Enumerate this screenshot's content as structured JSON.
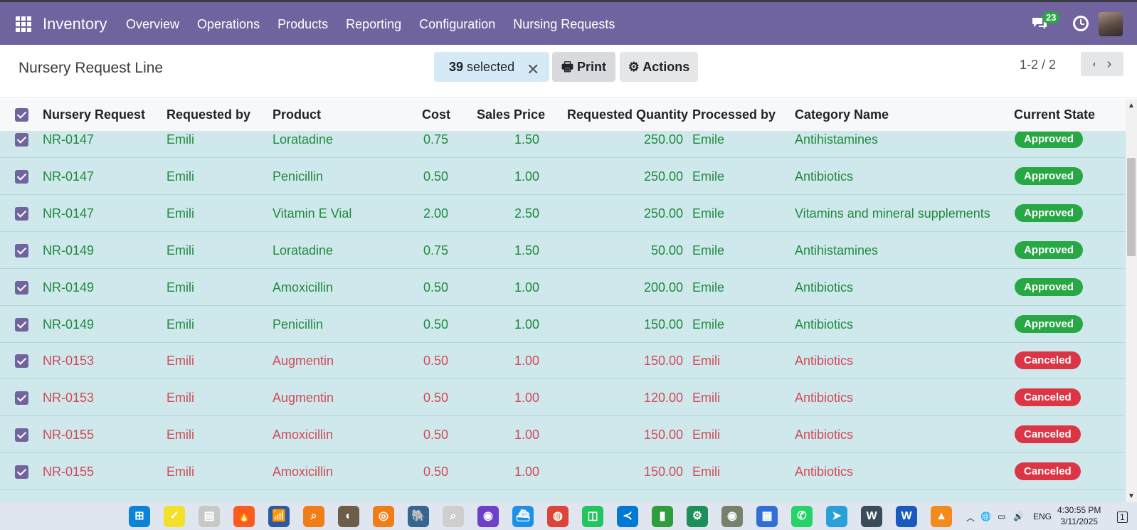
{
  "app": {
    "name": "Inventory",
    "menu": [
      "Overview",
      "Operations",
      "Products",
      "Reporting",
      "Configuration",
      "Nursing Requests"
    ],
    "messages_count": "23"
  },
  "control": {
    "title": "Nursery Request Line",
    "selected_count": "39",
    "selected_label": "selected",
    "print_label": "Print",
    "actions_label": "Actions",
    "pager": "1-2 / 2"
  },
  "columns": [
    "Nursery Request",
    "Requested by",
    "Product",
    "Cost",
    "Sales Price",
    "Requested Quantity",
    "Processed by",
    "Category Name",
    "Current State"
  ],
  "rows": [
    {
      "ref": "NR-0147",
      "requested_by": "Emili",
      "product": "Loratadine",
      "cost": "0.75",
      "sales_price": "1.50",
      "qty": "250.00",
      "processed_by": "Emile",
      "category": "Antihistamines",
      "state": "Approved"
    },
    {
      "ref": "NR-0147",
      "requested_by": "Emili",
      "product": "Penicillin",
      "cost": "0.50",
      "sales_price": "1.00",
      "qty": "250.00",
      "processed_by": "Emile",
      "category": "Antibiotics",
      "state": "Approved"
    },
    {
      "ref": "NR-0147",
      "requested_by": "Emili",
      "product": "Vitamin E Vial",
      "cost": "2.00",
      "sales_price": "2.50",
      "qty": "250.00",
      "processed_by": "Emile",
      "category": "Vitamins and mineral supplements",
      "state": "Approved"
    },
    {
      "ref": "NR-0149",
      "requested_by": "Emili",
      "product": "Loratadine",
      "cost": "0.75",
      "sales_price": "1.50",
      "qty": "50.00",
      "processed_by": "Emile",
      "category": "Antihistamines",
      "state": "Approved"
    },
    {
      "ref": "NR-0149",
      "requested_by": "Emili",
      "product": "Amoxicillin",
      "cost": "0.50",
      "sales_price": "1.00",
      "qty": "200.00",
      "processed_by": "Emile",
      "category": "Antibiotics",
      "state": "Approved"
    },
    {
      "ref": "NR-0149",
      "requested_by": "Emili",
      "product": "Penicillin",
      "cost": "0.50",
      "sales_price": "1.00",
      "qty": "150.00",
      "processed_by": "Emile",
      "category": "Antibiotics",
      "state": "Approved"
    },
    {
      "ref": "NR-0153",
      "requested_by": "Emili",
      "product": "Augmentin",
      "cost": "0.50",
      "sales_price": "1.00",
      "qty": "150.00",
      "processed_by": "Emili",
      "category": "Antibiotics",
      "state": "Canceled"
    },
    {
      "ref": "NR-0153",
      "requested_by": "Emili",
      "product": "Augmentin",
      "cost": "0.50",
      "sales_price": "1.00",
      "qty": "120.00",
      "processed_by": "Emili",
      "category": "Antibiotics",
      "state": "Canceled"
    },
    {
      "ref": "NR-0155",
      "requested_by": "Emili",
      "product": "Amoxicillin",
      "cost": "0.50",
      "sales_price": "1.00",
      "qty": "150.00",
      "processed_by": "Emili",
      "category": "Antibiotics",
      "state": "Canceled"
    },
    {
      "ref": "NR-0155",
      "requested_by": "Emili",
      "product": "Amoxicillin",
      "cost": "0.50",
      "sales_price": "1.00",
      "qty": "150.00",
      "processed_by": "Emili",
      "category": "Antibiotics",
      "state": "Canceled"
    }
  ],
  "colors": {
    "navbar": "#71639e",
    "approved": "#28a745",
    "canceled": "#dc3545",
    "row_bg": "#cfe8ec"
  },
  "taskbar": {
    "icons": [
      "windows-start-icon",
      "sticky-notes-icon",
      "file-explorer-icon",
      "fire-icon",
      "wireless-icon",
      "search-magnifier-icon",
      "gimp-icon",
      "blender-icon",
      "postgres-icon",
      "search-app-icon",
      "github-icon",
      "docker-icon",
      "chrome-icon",
      "screen-capture-icon",
      "vscode-icon",
      "pipe-icon",
      "gear-app-icon",
      "eye-app-icon",
      "grid-app-icon",
      "whatsapp-icon",
      "telegram-icon",
      "wordpress-icon",
      "word-icon",
      "vlc-icon"
    ],
    "language": "ENG",
    "time": "4:30:55 PM",
    "date": "3/11/2025",
    "notification_count": "1"
  }
}
